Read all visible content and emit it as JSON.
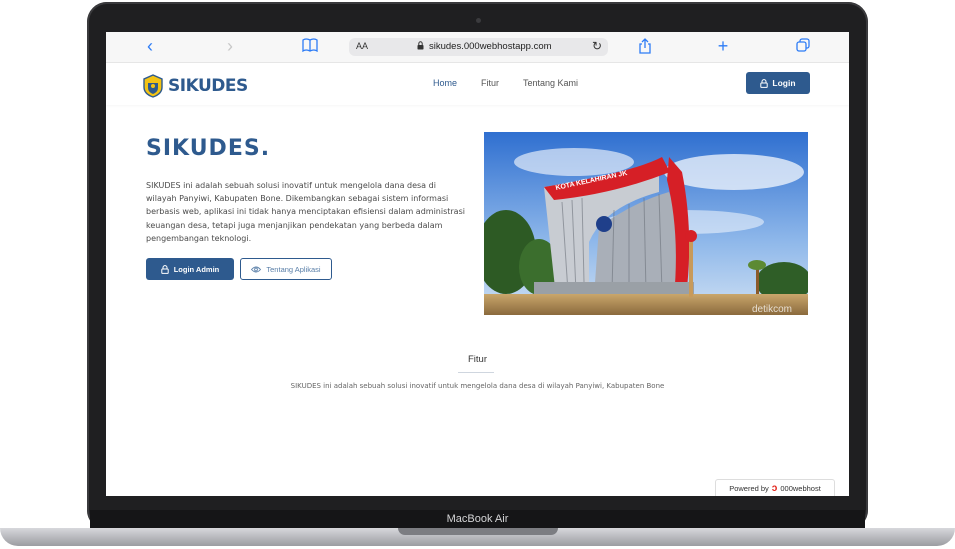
{
  "device": {
    "label": "MacBook Air"
  },
  "browser": {
    "back_icon": "‹",
    "forward_icon": "›",
    "bookmarks_icon": "book-icon",
    "reader_label": "AA",
    "url": "sikudes.000webhostapp.com",
    "reload_icon": "↻",
    "share_icon": "share-icon",
    "new_tab_icon": "+",
    "tabs_icon": "tabs-icon"
  },
  "navbar": {
    "brand": "SIKUDES",
    "links": [
      {
        "label": "Home",
        "active": true
      },
      {
        "label": "Fitur",
        "active": false
      },
      {
        "label": "Tentang Kami",
        "active": false
      }
    ],
    "login_label": "Login"
  },
  "hero": {
    "title": "SIKUDES.",
    "description": "SIKUDES ini adalah sebuah solusi inovatif untuk mengelola dana desa di wilayah Panyiwi, Kabupaten Bone. Dikembangkan sebagai sistem informasi berbasis web, aplikasi ini tidak hanya menciptakan efisiensi dalam administrasi keuangan desa, tetapi juga menjanjikan pendekatan yang berbeda dalam pengembangan teknologi.",
    "primary_button": "Login Admin",
    "secondary_button": "Tentang Aplikasi",
    "image_sign_text": "KOTA KELAHIRAN JK",
    "image_watermark": "detikcom"
  },
  "features": {
    "title": "Fitur",
    "description": "SIKUDES ini adalah sebuah solusi inovatif untuk mengelola dana desa di wilayah Panyiwi, Kabupaten Bone"
  },
  "footer_badge": {
    "prefix": "Powered by",
    "brand": "000webhost"
  },
  "colors": {
    "brand": "#2e5a8e",
    "browser_accent": "#2d7cf6"
  }
}
